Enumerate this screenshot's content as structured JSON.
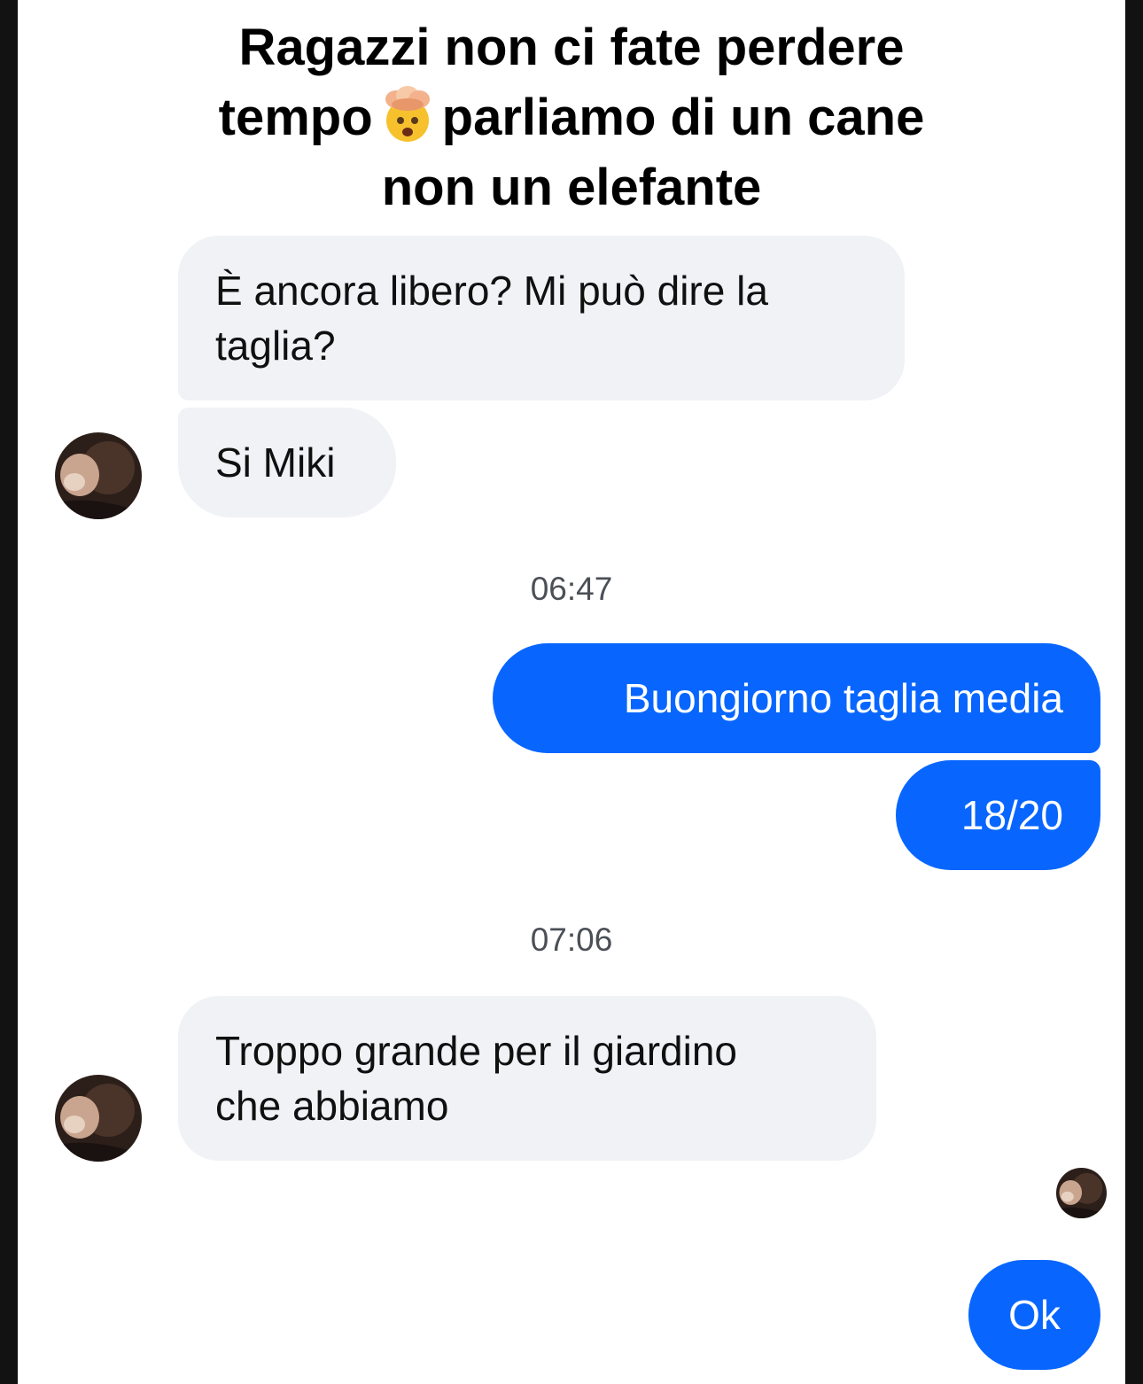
{
  "caption": {
    "line1": "Ragazzi non ci fate perdere",
    "line2_before": "tempo",
    "line2_emoji": "exploding-head-icon",
    "line2_after": "parliamo di un cane",
    "line3": "non un elefante"
  },
  "chat": {
    "messages": [
      {
        "sender": "contact",
        "text_line1": "È ancora libero? Mi può dire la",
        "text_line2": "taglia?"
      },
      {
        "sender": "contact",
        "text": "Si Miki"
      },
      {
        "sender": "me",
        "text": "Buongiorno taglia media"
      },
      {
        "sender": "me",
        "text": "18/20"
      },
      {
        "sender": "contact",
        "text_line1": "Troppo grande per il giardino",
        "text_line2": "che abbiamo"
      },
      {
        "sender": "me",
        "text": "Ok"
      }
    ],
    "timestamps": [
      "06:47",
      "07:06"
    ],
    "icons": [
      "avatar-contact",
      "avatar-contact",
      "avatar-read-receipt"
    ]
  },
  "colors": {
    "outgoing_bubble": "#0866ff",
    "incoming_bubble": "#f0f2f5",
    "page_frame": "#121212",
    "timestamp_text": "#4b4f56"
  }
}
